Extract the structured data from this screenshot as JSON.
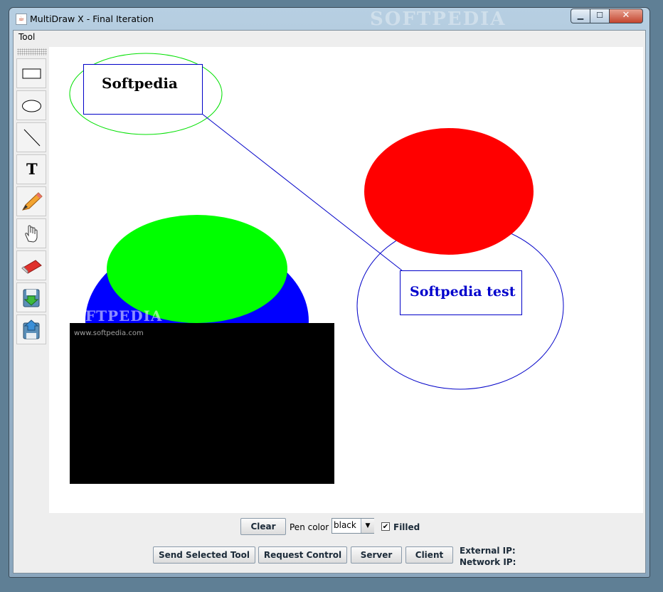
{
  "window": {
    "title": "MultiDraw X - Final Iteration",
    "title_watermark": "SOFTPEDIA",
    "controls": {
      "minimize": "▁",
      "maximize": "☐",
      "close": "✕"
    }
  },
  "menubar": {
    "items": [
      "Tool"
    ]
  },
  "toolbar": {
    "tools": [
      {
        "name": "rectangle-tool",
        "icon": "rectangle-icon"
      },
      {
        "name": "ellipse-tool",
        "icon": "ellipse-icon"
      },
      {
        "name": "line-tool",
        "icon": "line-icon"
      },
      {
        "name": "text-tool",
        "icon": "text-icon",
        "glyph": "T"
      },
      {
        "name": "pencil-tool",
        "icon": "pencil-icon"
      },
      {
        "name": "hand-tool",
        "icon": "hand-icon"
      },
      {
        "name": "eraser-tool",
        "icon": "eraser-icon"
      },
      {
        "name": "save-tool",
        "icon": "save-icon"
      },
      {
        "name": "open-tool",
        "icon": "open-icon"
      }
    ]
  },
  "canvas": {
    "texts": {
      "label_1": "Softpedia",
      "label_2": "Softpedia test",
      "watermark_logo": "SOFTPEDIA",
      "watermark_url": "www.softpedia.com"
    },
    "colors": {
      "green": "#00ff00",
      "red": "#ff0000",
      "blue": "#0000ff",
      "black": "#000000"
    }
  },
  "controls": {
    "clear": "Clear",
    "pen_color_label": "Pen color",
    "pen_color_value": "black",
    "filled_label": "Filled",
    "filled_checked": true,
    "checkmark": "✔",
    "send_tool": "Send Selected Tool",
    "request_control": "Request Control",
    "server": "Server",
    "client": "Client",
    "external_ip_label": "External IP:",
    "network_ip_label": "Network IP:"
  }
}
